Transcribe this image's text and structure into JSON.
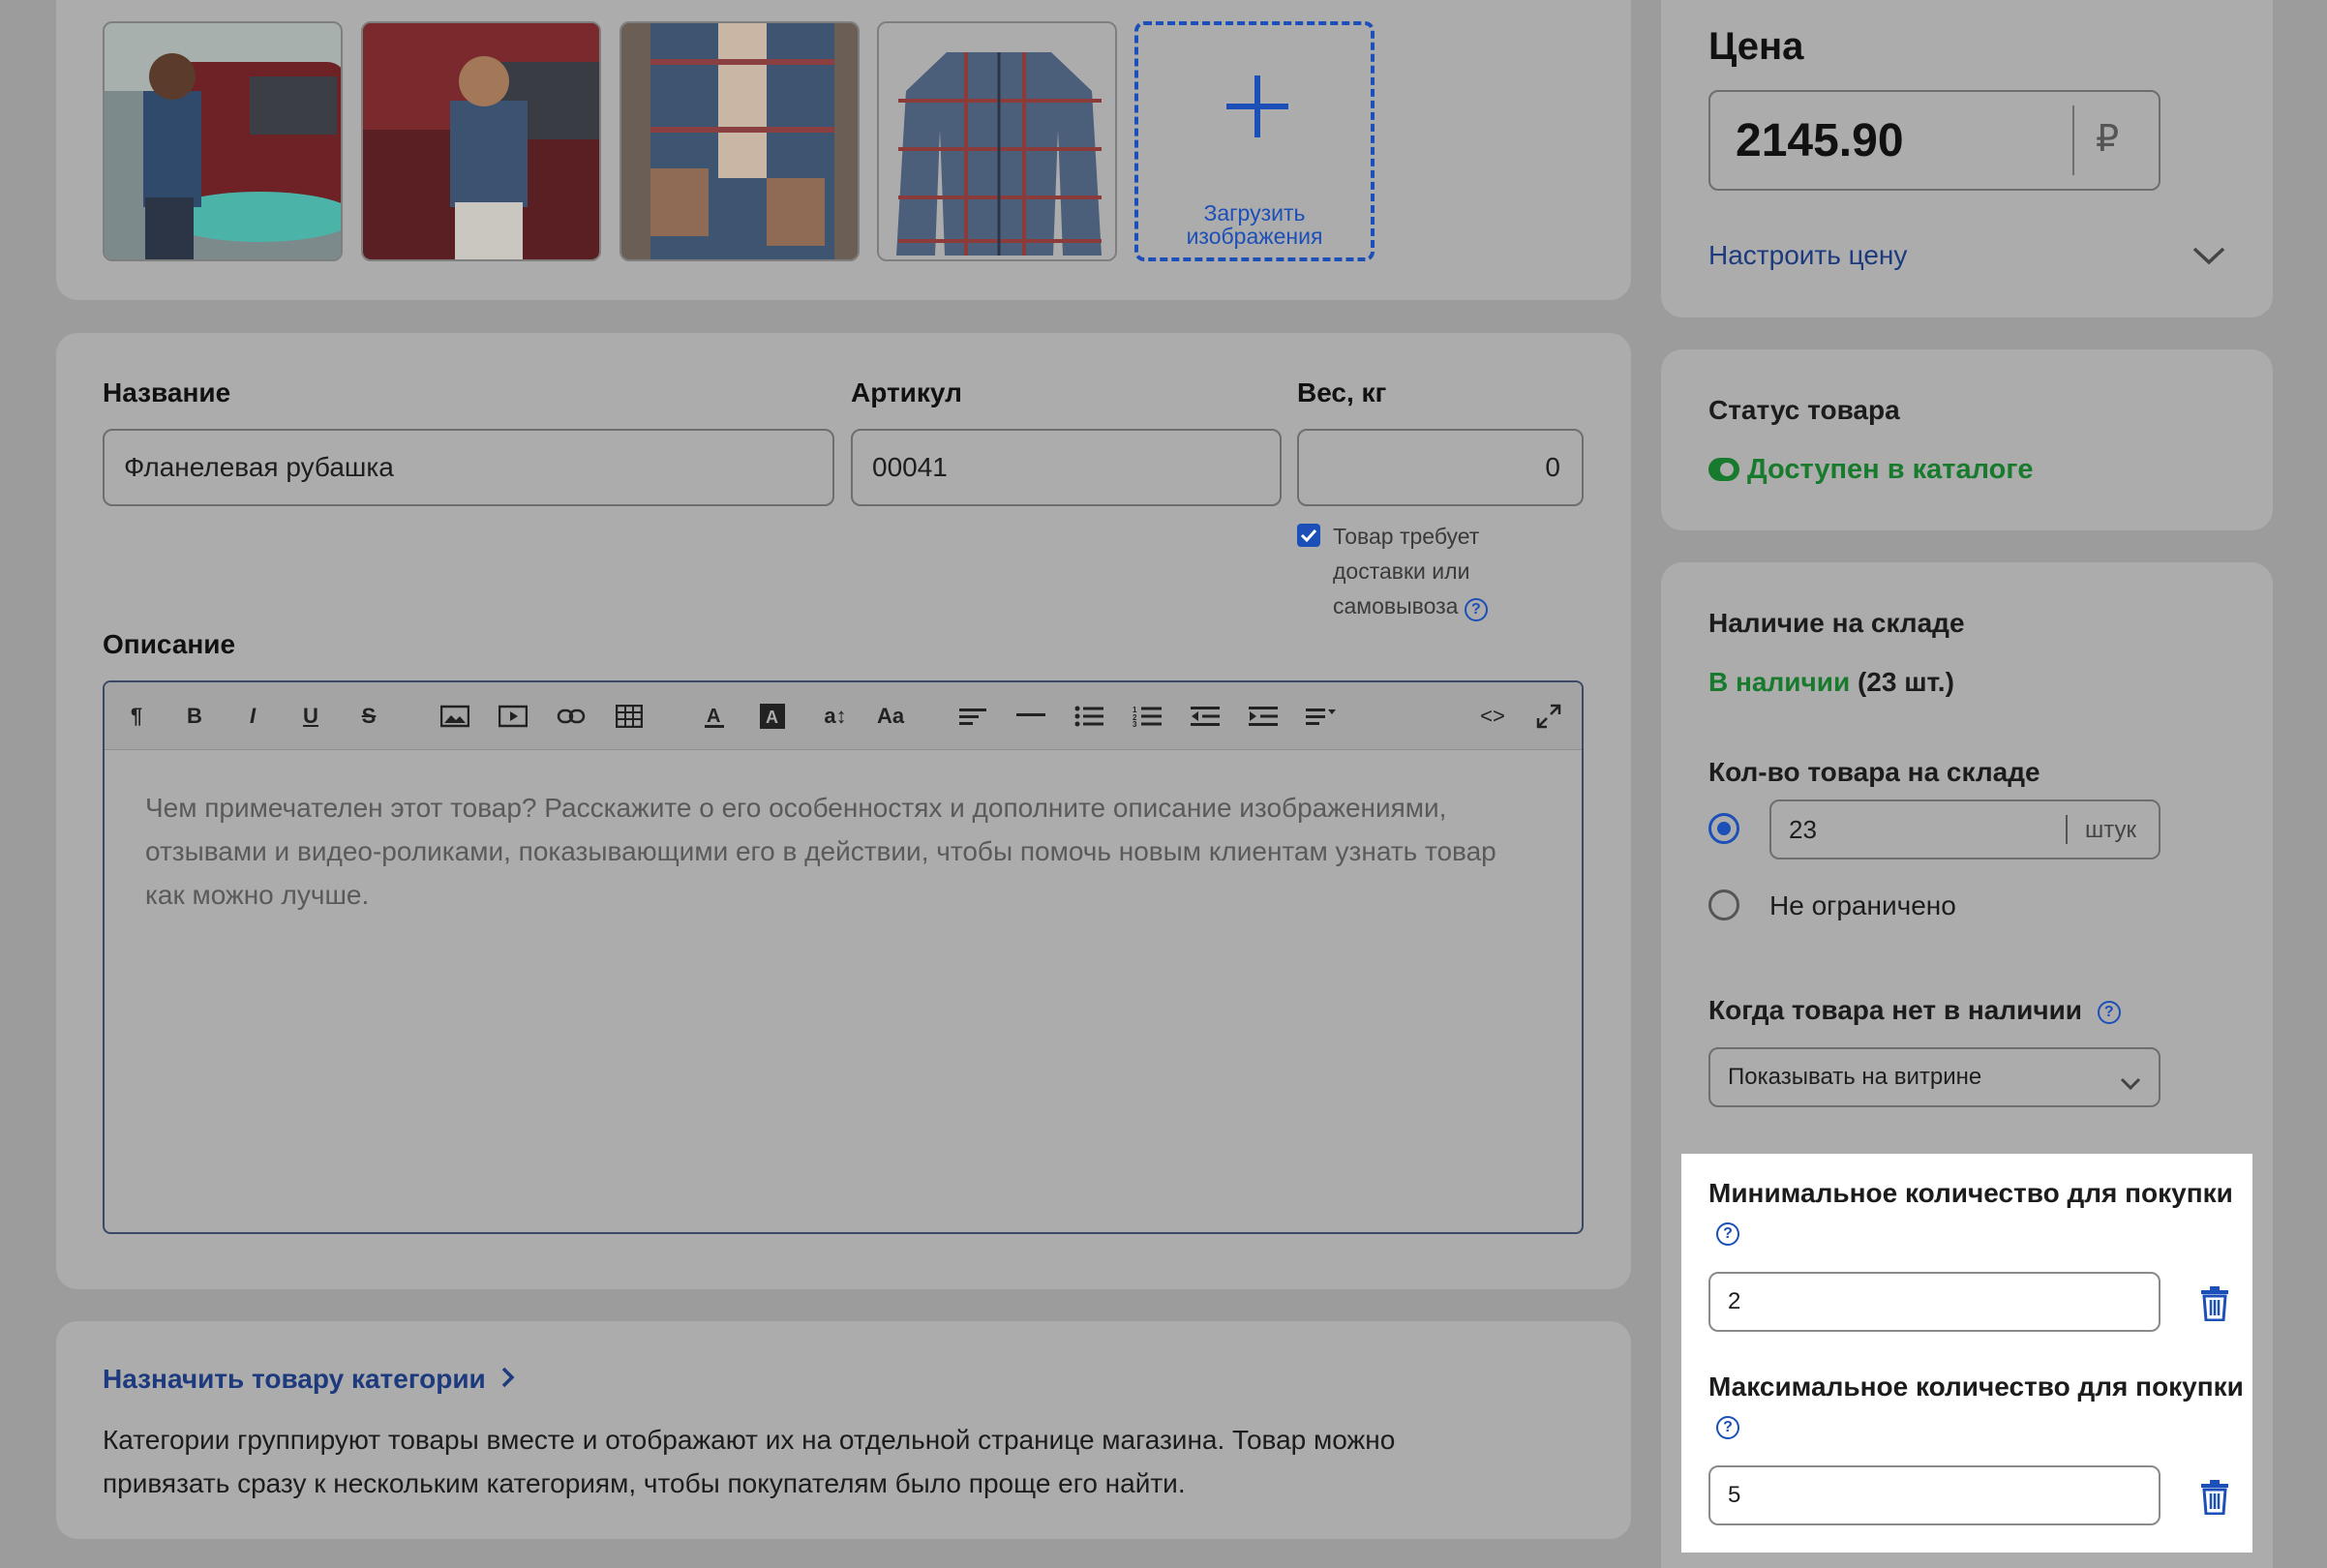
{
  "images": {
    "upload_label": "Загрузить изображения"
  },
  "product": {
    "name_label": "Название",
    "name_value": "Фланелевая рубашка",
    "sku_label": "Артикул",
    "sku_value": "00041",
    "weight_label": "Вес, кг",
    "weight_value": "0",
    "shipping_checkbox_label": "Товар требует доставки или самовывоза",
    "shipping_checked": true,
    "description_label": "Описание",
    "description_placeholder": "Чем примечателен этот товар? Расскажите о его особенностях и дополните описание изображениями, отзывами и видео-роликами, показывающими его в действии, чтобы помочь новым клиентам узнать товар как можно лучше."
  },
  "toolbar": {
    "icons": [
      "paragraph-icon",
      "bold-icon",
      "italic-icon",
      "underline-icon",
      "strikethrough-icon",
      "insert-image-icon",
      "insert-video-icon",
      "link-icon",
      "table-icon",
      "font-color-icon",
      "highlight-icon",
      "font-size-icon",
      "text-case-icon",
      "align-icon",
      "horizontal-rule-icon",
      "bulleted-list-icon",
      "numbered-list-icon",
      "outdent-icon",
      "indent-icon",
      "more-formatting-icon",
      "code-view-icon",
      "fullscreen-icon"
    ],
    "glyphs": {
      "paragraph": "¶",
      "bold": "B",
      "italic": "I",
      "underline": "U",
      "strike": "S",
      "fontsize": "a↕",
      "textcase": "Aa",
      "code": "<>"
    }
  },
  "categories": {
    "link_label": "Назначить товару категории",
    "description": "Категории группируют товары вместе и отображают их на отдельной странице магазина. Товар можно привязать сразу к нескольким категориям, чтобы покупателям было проще его найти."
  },
  "price": {
    "title": "Цена",
    "value": "2145.90",
    "currency": "₽",
    "configure_label": "Настроить цену"
  },
  "status": {
    "title": "Статус товара",
    "value": "Доступен в каталоге",
    "enabled": true
  },
  "stock": {
    "title": "Наличие на складе",
    "in_stock_label": "В наличии",
    "in_stock_count": "(23 шт.)",
    "quantity_label": "Кол-во товара на складе",
    "quantity_value": "23",
    "quantity_unit": "штук",
    "unlimited_label": "Не ограничено",
    "out_of_stock_label": "Когда товара нет в наличии",
    "out_of_stock_option": "Показывать на витрине",
    "min_purchase_label": "Минимальное количество для покупки",
    "min_purchase_value": "2",
    "max_purchase_label": "Максимальное количество для покупки",
    "max_purchase_value": "5"
  },
  "colors": {
    "accent": "#1c4fb8",
    "link": "#1c3a7d",
    "success": "#177a2c",
    "overlay": "#9c9c9c",
    "highlight_bg": "#ffffff"
  }
}
